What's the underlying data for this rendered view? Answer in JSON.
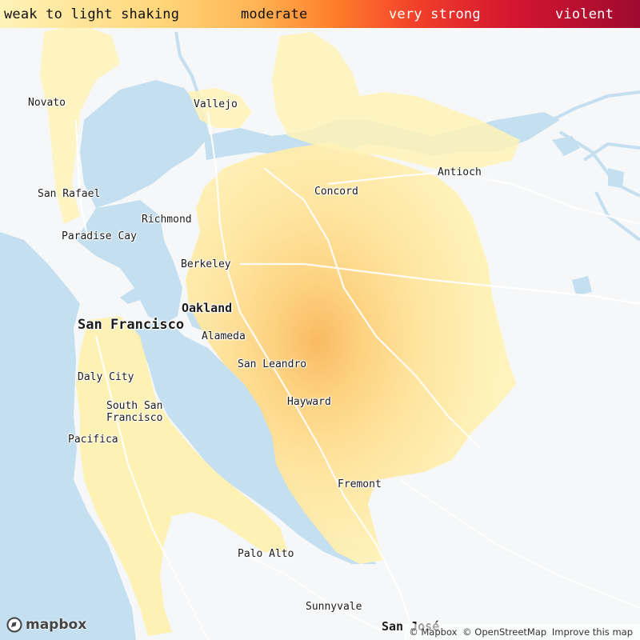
{
  "legend": {
    "weak": "weak to light shaking",
    "moderate": "moderate",
    "very_strong": "very strong",
    "violent": "violent"
  },
  "places": {
    "novato": "Novato",
    "vallejo": "Vallejo",
    "antioch": "Antioch",
    "san_rafael": "San Rafael",
    "concord": "Concord",
    "richmond": "Richmond",
    "paradise_cay": "Paradise Cay",
    "berkeley": "Berkeley",
    "oakland": "Oakland",
    "san_francisco": "San Francisco",
    "alameda": "Alameda",
    "san_leandro": "San Leandro",
    "daly_city": "Daly City",
    "hayward": "Hayward",
    "south_san_francisco_1": "South San",
    "south_san_francisco_2": "Francisco",
    "pacifica": "Pacifica",
    "fremont": "Fremont",
    "palo_alto": "Palo Alto",
    "sunnyvale": "Sunnyvale",
    "san_jose": "San José"
  },
  "logo": {
    "text": "mapbox",
    "icon": "mapbox-icon"
  },
  "attribution": {
    "mapbox": "© Mapbox",
    "osm": "© OpenStreetMap",
    "improve": "Improve this map"
  },
  "colors": {
    "water": "#c4dff0",
    "land": "#f6f7f8",
    "shaking_weak": "#fff5bd",
    "shaking_light": "#ffe89a",
    "shaking_moderate": "#ffd27c",
    "shaking_peak": "#fbbf5c"
  }
}
